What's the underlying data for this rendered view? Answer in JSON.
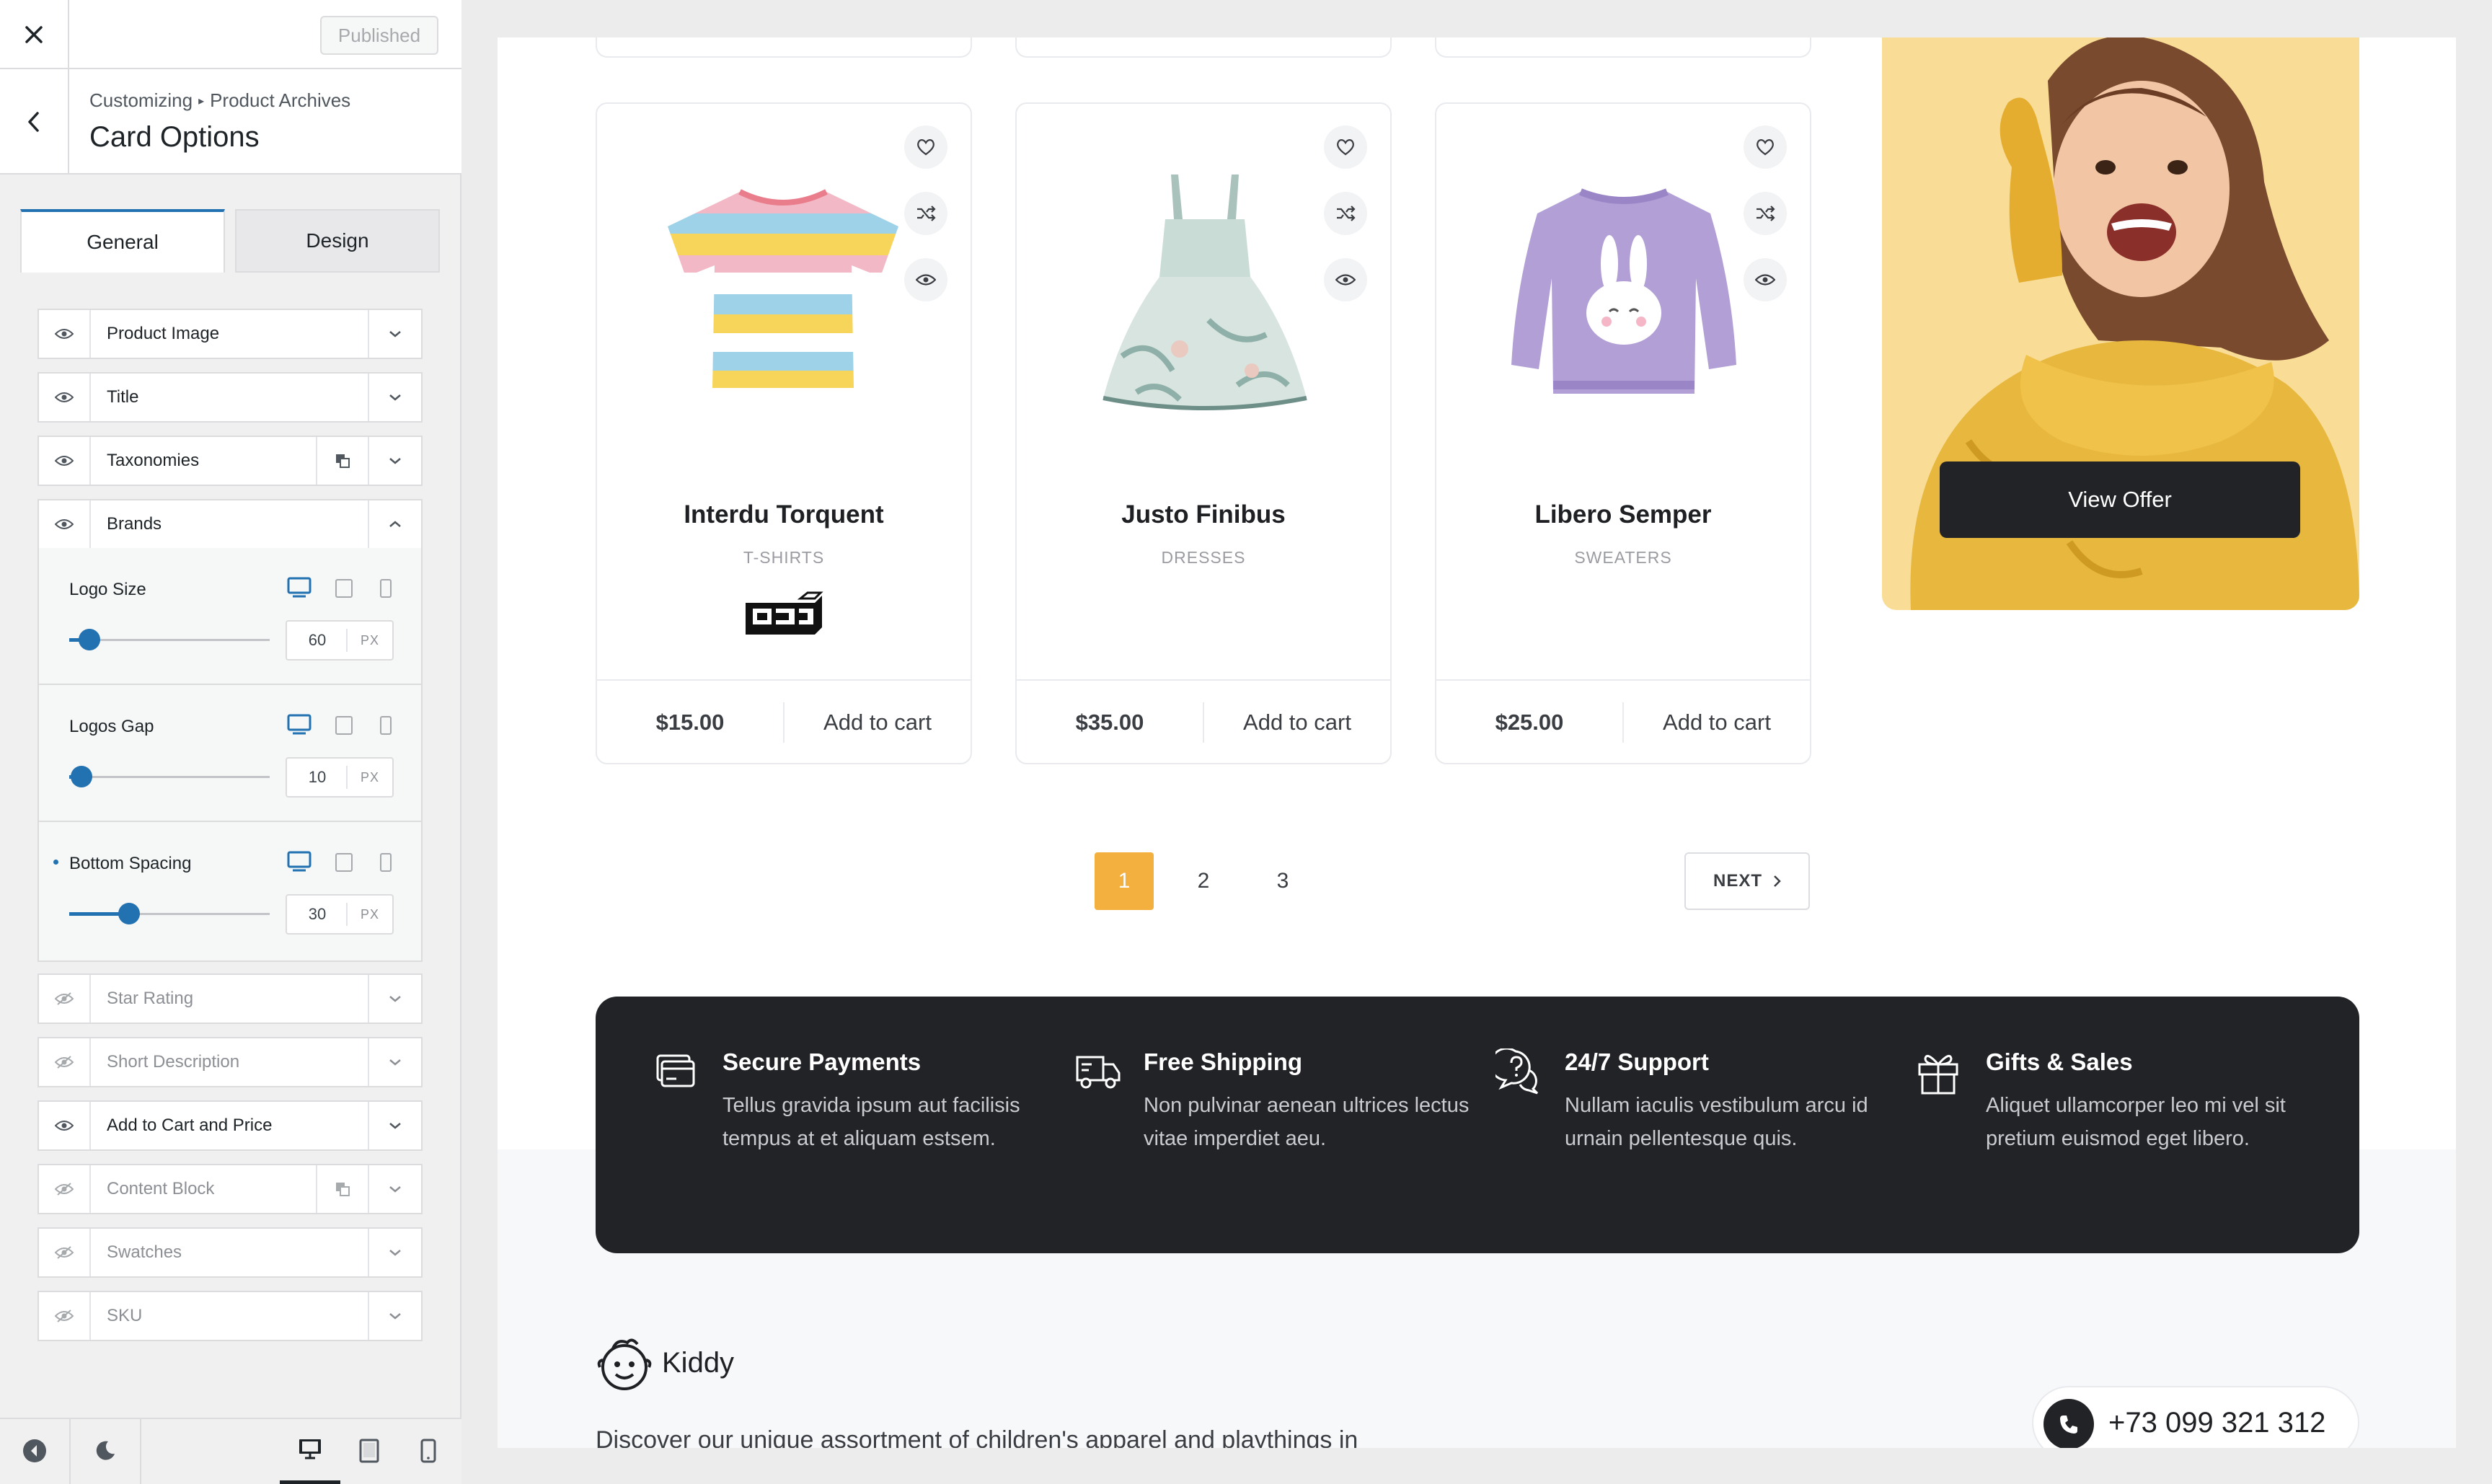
{
  "topbar": {
    "published_label": "Published"
  },
  "panel": {
    "crumb_root": "Customizing",
    "crumb_section": "Product Archives",
    "title": "Card Options"
  },
  "tabs": [
    {
      "label": "General",
      "active": true
    },
    {
      "label": "Design",
      "active": false
    }
  ],
  "options": [
    {
      "label": "Product Image",
      "visible": true
    },
    {
      "label": "Title",
      "visible": true
    },
    {
      "label": "Taxonomies",
      "visible": true,
      "duplicate": true
    },
    {
      "label": "Brands",
      "visible": true,
      "expanded": true
    },
    {
      "label": "Star Rating",
      "visible": false
    },
    {
      "label": "Short Description",
      "visible": false
    },
    {
      "label": "Add to Cart and Price",
      "visible": true
    },
    {
      "label": "Content Block",
      "visible": false,
      "duplicate": true
    },
    {
      "label": "Swatches",
      "visible": false
    },
    {
      "label": "SKU",
      "visible": false
    }
  ],
  "brands_settings": [
    {
      "label": "Logo Size",
      "value": "60",
      "unit": "PX",
      "slider_fraction": 0.1,
      "modified": false
    },
    {
      "label": "Logos Gap",
      "value": "10",
      "unit": "PX",
      "slider_fraction": 0.06,
      "modified": false
    },
    {
      "label": "Bottom Spacing",
      "value": "30",
      "unit": "PX",
      "slider_fraction": 0.3,
      "modified": true
    }
  ],
  "accent_color": "#2271b1",
  "products": [
    {
      "title": "Interdu Torquent",
      "category": "T-SHIRTS",
      "price": "$15.00",
      "cart_label": "Add to cart",
      "has_brand_logo": true
    },
    {
      "title": "Justo Finibus",
      "category": "DRESSES",
      "price": "$35.00",
      "cart_label": "Add to cart",
      "has_brand_logo": false
    },
    {
      "title": "Libero Semper",
      "category": "SWEATERS",
      "price": "$25.00",
      "cart_label": "Add to cart",
      "has_brand_logo": false
    }
  ],
  "promo": {
    "button_label": "View Offer",
    "bg_color": "#f9dd96"
  },
  "pagination": {
    "pages": [
      "1",
      "2",
      "3"
    ],
    "current": "1",
    "next_label": "NEXT"
  },
  "features": [
    {
      "icon": "credit-card-icon",
      "title": "Secure Payments",
      "desc": "Tellus gravida ipsum aut facilisis tempus at et aliquam estsem."
    },
    {
      "icon": "truck-icon",
      "title": "Free Shipping",
      "desc": "Non pulvinar aenean ultrices lectus vitae imperdiet aeu."
    },
    {
      "icon": "support-chat-icon",
      "title": "24/7 Support",
      "desc": "Nullam iaculis vestibulum arcu id urnain pellentesque quis."
    },
    {
      "icon": "gift-icon",
      "title": "Gifts & Sales",
      "desc": "Aliquet ullamcorper leo mi vel sit pretium euismod eget libero."
    }
  ],
  "footer": {
    "brand_name": "Kiddy",
    "about_text": "Discover our unique assortment of children's apparel and playthings in",
    "phone": "+73 099 321 312"
  }
}
